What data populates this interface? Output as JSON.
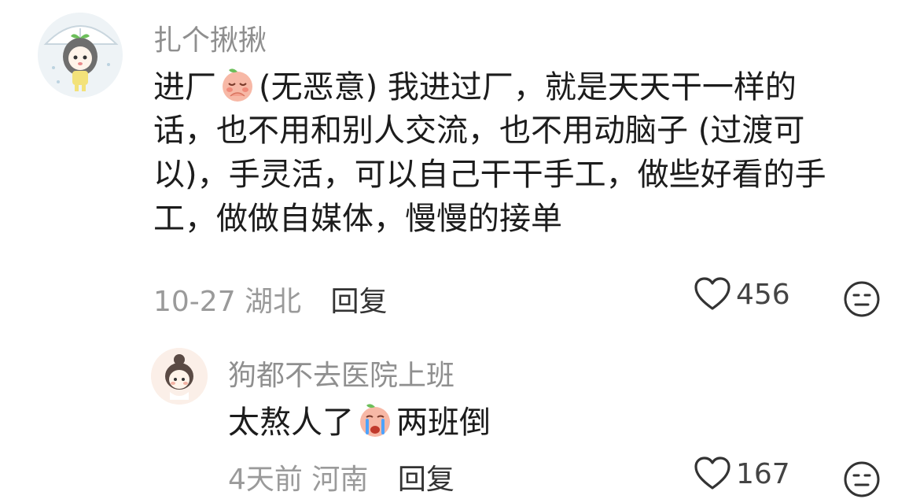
{
  "comments": [
    {
      "username": "扎个揪揪",
      "avatar_icon": "girl-with-umbrella-avatar",
      "body_lines": [
        {
          "before_emoji": "进厂",
          "emoji": "blushing-peach-emoji",
          "after_emoji": "(无恶意) 我进过厂，就是天天干一样的"
        },
        {
          "text": "话，也不用和别人交流，也不用动脑子 (过渡可"
        },
        {
          "text": "以)，手灵活，可以自己干干手工，做些好看的手"
        },
        {
          "text": "工，做做自媒体，慢慢的接单"
        }
      ],
      "date": "10-27",
      "location": "湖北",
      "reply_label": "回复",
      "likes": "456",
      "like_icon": "heart-icon",
      "dislike_icon": "meh-face-icon"
    },
    {
      "username": "狗都不去医院上班",
      "avatar_icon": "girl-bun-avatar",
      "body": {
        "before_emoji": "太熬人了",
        "emoji": "crying-peach-emoji",
        "after_emoji": "两班倒"
      },
      "date": "4天前",
      "location": "河南",
      "reply_label": "回复",
      "likes": "167",
      "like_icon": "heart-icon",
      "dislike_icon": "meh-face-icon"
    }
  ],
  "colors": {
    "username": "#8f8f8f",
    "text": "#1c1c1c",
    "meta": "#9a9a9a",
    "peach": "#f7a38f",
    "peach_leaf": "#6cbf5a"
  }
}
